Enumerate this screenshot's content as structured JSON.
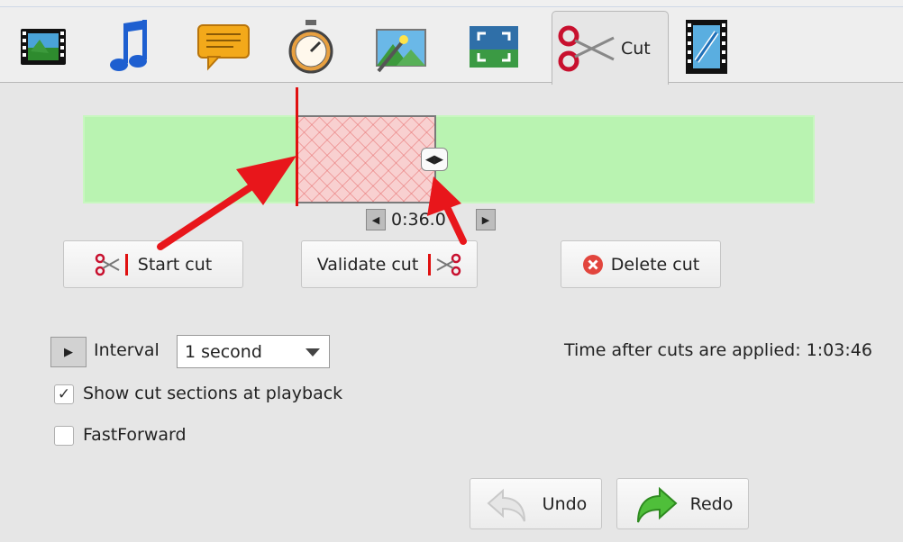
{
  "tabs": [
    {
      "icon": "video-film-icon",
      "label": ""
    },
    {
      "icon": "music-note-icon",
      "label": ""
    },
    {
      "icon": "speech-bubble-icon",
      "label": ""
    },
    {
      "icon": "stopwatch-icon",
      "label": ""
    },
    {
      "icon": "magic-image-icon",
      "label": ""
    },
    {
      "icon": "fullscreen-frame-icon",
      "label": ""
    },
    {
      "icon": "scissors-icon",
      "label": "Cut"
    },
    {
      "icon": "film-link-icon",
      "label": ""
    }
  ],
  "timeline": {
    "current_time": "0:36.0",
    "colors": {
      "track": "#b9f3b1",
      "cut": "#f8d0d0",
      "cursor": "#e01010"
    }
  },
  "actions": {
    "start_cut": "Start cut",
    "validate_cut": "Validate cut",
    "delete_cut": "Delete cut"
  },
  "interval": {
    "label": "Interval",
    "value": "1 second"
  },
  "time_after": "Time after cuts are applied: 1:03:46",
  "options": {
    "show_cut_sections": {
      "label": "Show cut sections at playback",
      "checked": true
    },
    "fast_forward": {
      "label": "FastForward",
      "checked": false
    }
  },
  "history": {
    "undo": "Undo",
    "redo": "Redo"
  },
  "annotation_color": "#e8161b"
}
